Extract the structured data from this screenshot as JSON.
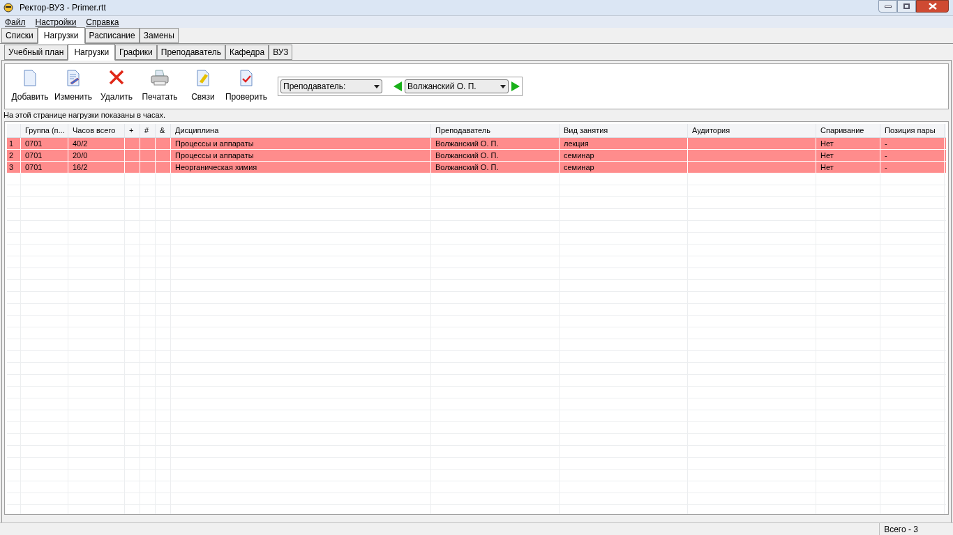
{
  "window": {
    "title": "Ректор-ВУЗ - Primer.rtt"
  },
  "menu": [
    {
      "label": "Файл"
    },
    {
      "label": "Настройки"
    },
    {
      "label": "Справка"
    }
  ],
  "tabs": [
    {
      "label": "Списки",
      "selected": false
    },
    {
      "label": "Нагрузки",
      "selected": true
    },
    {
      "label": "Расписание",
      "selected": false
    },
    {
      "label": "Замены",
      "selected": false
    }
  ],
  "subtabs": [
    {
      "label": "Учебный план",
      "selected": false
    },
    {
      "label": "Нагрузки",
      "selected": true
    },
    {
      "label": "Графики",
      "selected": false
    },
    {
      "label": "Преподаватель",
      "selected": false
    },
    {
      "label": "Кафедра",
      "selected": false
    },
    {
      "label": "ВУЗ",
      "selected": false
    }
  ],
  "toolbar": [
    {
      "kind": "add",
      "label": "Добавить"
    },
    {
      "kind": "edit",
      "label": "Изменить"
    },
    {
      "kind": "delete",
      "label": "Удалить"
    },
    {
      "kind": "print",
      "label": "Печатать"
    },
    {
      "kind": "link",
      "label": "Связи"
    },
    {
      "kind": "check",
      "label": "Проверить"
    }
  ],
  "filter": {
    "type": "Преподаватель:",
    "value": "Волжанский О. П."
  },
  "info": "На этой странице нагрузки показаны в часах.",
  "table": {
    "columns": [
      "",
      "Группа (п...",
      "Часов всего",
      "+",
      "#",
      "&",
      "Дисциплина",
      "Преподаватель",
      "Вид занятия",
      "Аудитория",
      "Спаривание",
      "Позиция пары"
    ],
    "rows": [
      {
        "color": "#ff8c8c",
        "cells": [
          "1",
          "0701",
          "40/2",
          "",
          "",
          "",
          "Процессы и аппараты",
          "Волжанский О. П.",
          "лекция",
          "",
          "Нет",
          "-"
        ]
      },
      {
        "color": "#ff8c8c",
        "cells": [
          "2",
          "0701",
          "20/0",
          "",
          "",
          "",
          "Процессы и аппараты",
          "Волжанский О. П.",
          "семинар",
          "",
          "Нет",
          "-"
        ]
      },
      {
        "color": "#ff8c8c",
        "cells": [
          "3",
          "0701",
          "16/2",
          "",
          "",
          "",
          "Неорганическая химия",
          "Волжанский О. П.",
          "семинар",
          "",
          "Нет",
          "-"
        ]
      }
    ]
  },
  "status_bar": {
    "total": "Всего - 3"
  }
}
